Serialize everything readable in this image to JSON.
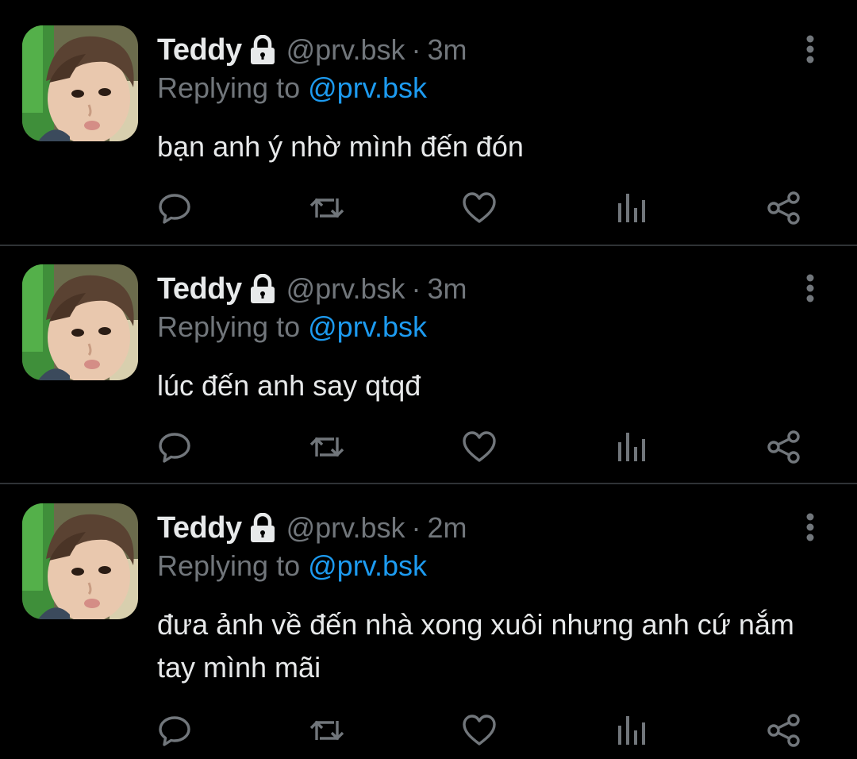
{
  "colors": {
    "background": "#000000",
    "text": "#e7e9ea",
    "muted": "#71767b",
    "link": "#1d9bf0",
    "divider": "#2f3336"
  },
  "tweets": [
    {
      "display_name": "Teddy",
      "locked_icon": "lock-icon",
      "handle": "@prv.bsk",
      "separator": "·",
      "time": "3m",
      "replying_prefix": "Replying to",
      "replying_to": "@prv.bsk",
      "text": "bạn anh ý nhờ mình đến đón",
      "actions": [
        "reply-icon",
        "retweet-icon",
        "like-icon",
        "analytics-icon",
        "share-icon"
      ]
    },
    {
      "display_name": "Teddy",
      "locked_icon": "lock-icon",
      "handle": "@prv.bsk",
      "separator": "·",
      "time": "3m",
      "replying_prefix": "Replying to",
      "replying_to": "@prv.bsk",
      "text": "lúc đến anh say qtqđ",
      "actions": [
        "reply-icon",
        "retweet-icon",
        "like-icon",
        "analytics-icon",
        "share-icon"
      ]
    },
    {
      "display_name": "Teddy",
      "locked_icon": "lock-icon",
      "handle": "@prv.bsk",
      "separator": "·",
      "time": "2m",
      "replying_prefix": "Replying to",
      "replying_to": "@prv.bsk",
      "text": "đưa ảnh về đến nhà xong xuôi nhưng anh cứ nắm tay mình mãi",
      "actions": [
        "reply-icon",
        "retweet-icon",
        "like-icon",
        "analytics-icon",
        "share-icon"
      ]
    }
  ]
}
